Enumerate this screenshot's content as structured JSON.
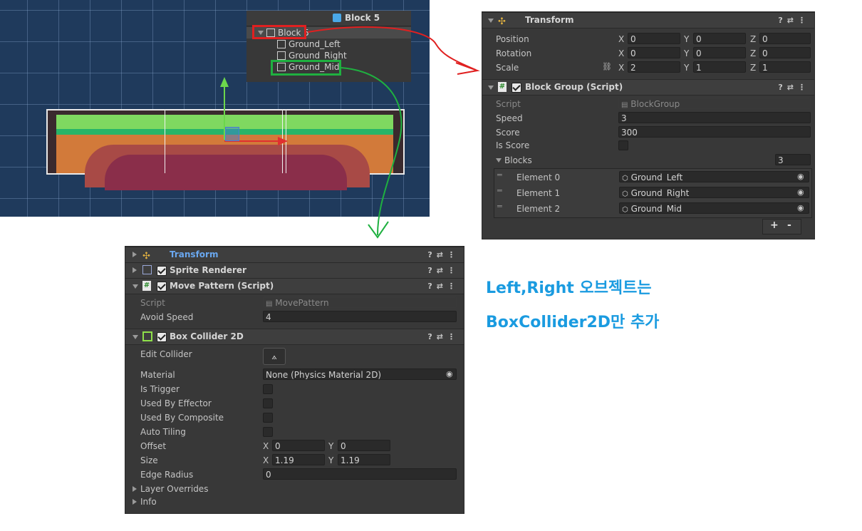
{
  "hierarchy": {
    "title": "Block 5",
    "items": [
      "Block 5",
      "Ground_Left",
      "Ground_Right",
      "Ground_Mid"
    ]
  },
  "block_inspector": {
    "transform": {
      "title": "Transform",
      "rows": [
        {
          "label": "Position",
          "x": "0",
          "y": "0",
          "z": "0"
        },
        {
          "label": "Rotation",
          "x": "0",
          "y": "0",
          "z": "0"
        },
        {
          "label": "Scale",
          "x": "2",
          "y": "1",
          "z": "1"
        }
      ],
      "axis": [
        "X",
        "Y",
        "Z"
      ]
    },
    "block_group": {
      "title": "Block Group (Script)",
      "script_label": "Script",
      "script_value": "BlockGroup",
      "speed_label": "Speed",
      "speed_value": "3",
      "score_label": "Score",
      "score_value": "300",
      "is_score_label": "Is Score",
      "blocks_label": "Blocks",
      "blocks_count": "3",
      "elements": [
        {
          "label": "Element 0",
          "value": "Ground_Left"
        },
        {
          "label": "Element 1",
          "value": "Ground_Right"
        },
        {
          "label": "Element 2",
          "value": "Ground_Mid"
        }
      ],
      "add_label": "+",
      "remove_label": "-"
    }
  },
  "mid_inspector": {
    "transform_title": "Transform",
    "sprite_title": "Sprite Renderer",
    "move_pattern": {
      "title": "Move Pattern (Script)",
      "script_label": "Script",
      "script_value": "MovePattern",
      "avoid_label": "Avoid Speed",
      "avoid_value": "4"
    },
    "box_collider": {
      "title": "Box Collider 2D",
      "edit_label": "Edit Collider",
      "material_label": "Material",
      "material_value": "None (Physics Material 2D)",
      "is_trigger": "Is Trigger",
      "used_effector": "Used By Effector",
      "used_composite": "Used By Composite",
      "auto_tiling": "Auto Tiling",
      "offset_label": "Offset",
      "offset_x": "0",
      "offset_y": "0",
      "size_label": "Size",
      "size_x": "1.19",
      "size_y": "1.19",
      "edge_label": "Edge Radius",
      "edge_value": "0",
      "layer_overrides": "Layer Overrides",
      "info": "Info"
    }
  },
  "annotation": {
    "line1": "Left,Right 오브젝트는",
    "line2": "BoxCollider2D만 추가"
  },
  "colors": {
    "annotation": "#1a9be0",
    "highlight_red": "#e02020",
    "highlight_green": "#1fb040",
    "cube_blue": "#4aa8e8"
  }
}
